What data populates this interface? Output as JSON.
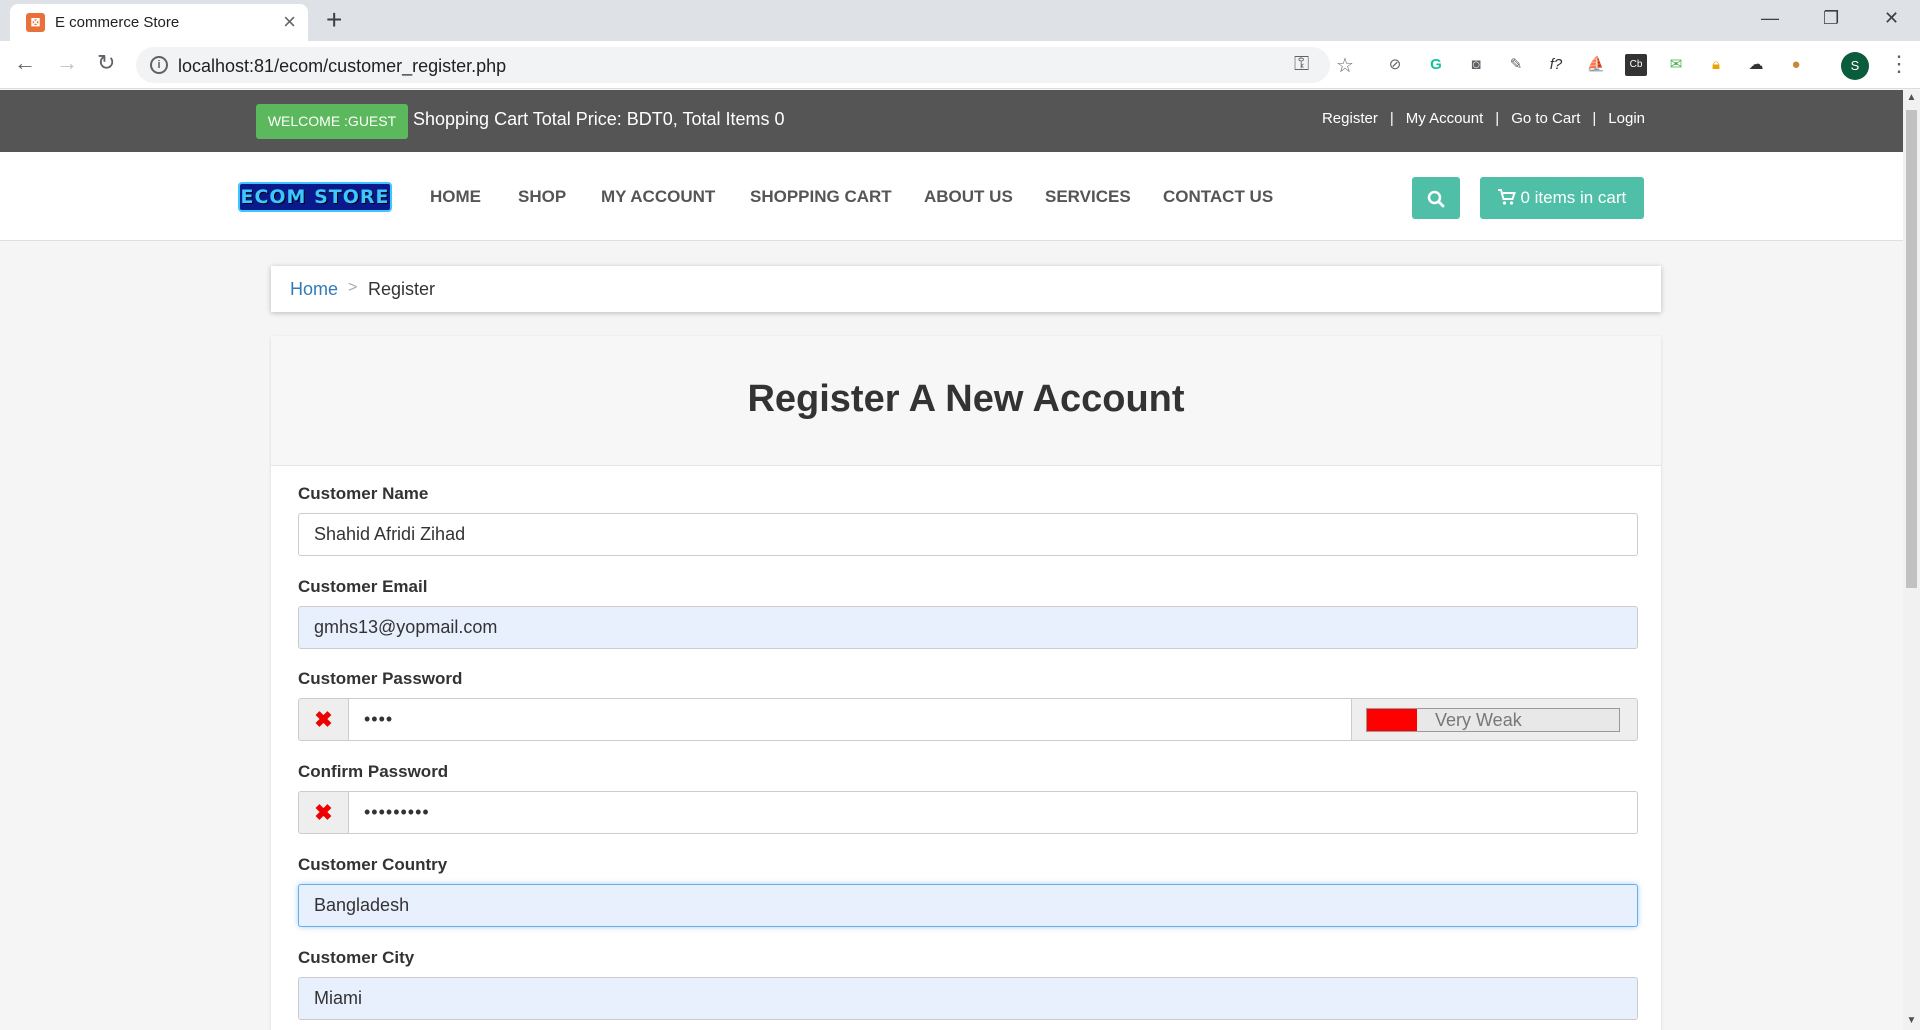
{
  "browser": {
    "tab_title": "E commerce Store",
    "url": "localhost:81/ecom/customer_register.php",
    "profile_initial": "S"
  },
  "topbar": {
    "welcome": "WELCOME :GUEST",
    "cart_summary": "Shopping Cart Total Price: BDT0, Total Items 0",
    "links": [
      "Register",
      "My Account",
      "Go to Cart",
      "Login"
    ]
  },
  "nav": {
    "logo": "ECOM STORE",
    "items": [
      "HOME",
      "SHOP",
      "MY ACCOUNT",
      "SHOPPING CART",
      "ABOUT US",
      "SERVICES",
      "CONTACT US"
    ],
    "cart_button": "0 items in cart"
  },
  "breadcrumb": {
    "home": "Home",
    "separator": ">",
    "current": "Register"
  },
  "form": {
    "title": "Register A New Account",
    "name_label": "Customer Name",
    "name_value": "Shahid Afridi Zihad",
    "email_label": "Customer Email",
    "email_value": "gmhs13@yopmail.com",
    "password_label": "Customer Password",
    "password_value": "••••",
    "strength_text": "Very Weak",
    "strength_level": 0.2,
    "confirm_label": "Confirm Password",
    "confirm_value": "•••••••••",
    "country_label": "Customer Country",
    "country_value": "Bangladesh",
    "city_label": "Customer City",
    "city_value": "Miami"
  },
  "colors": {
    "welcome_green": "#5cb85c",
    "accent_teal": "#4fbfa8",
    "topbar": "#555555",
    "strength_red": "#ff0000"
  }
}
